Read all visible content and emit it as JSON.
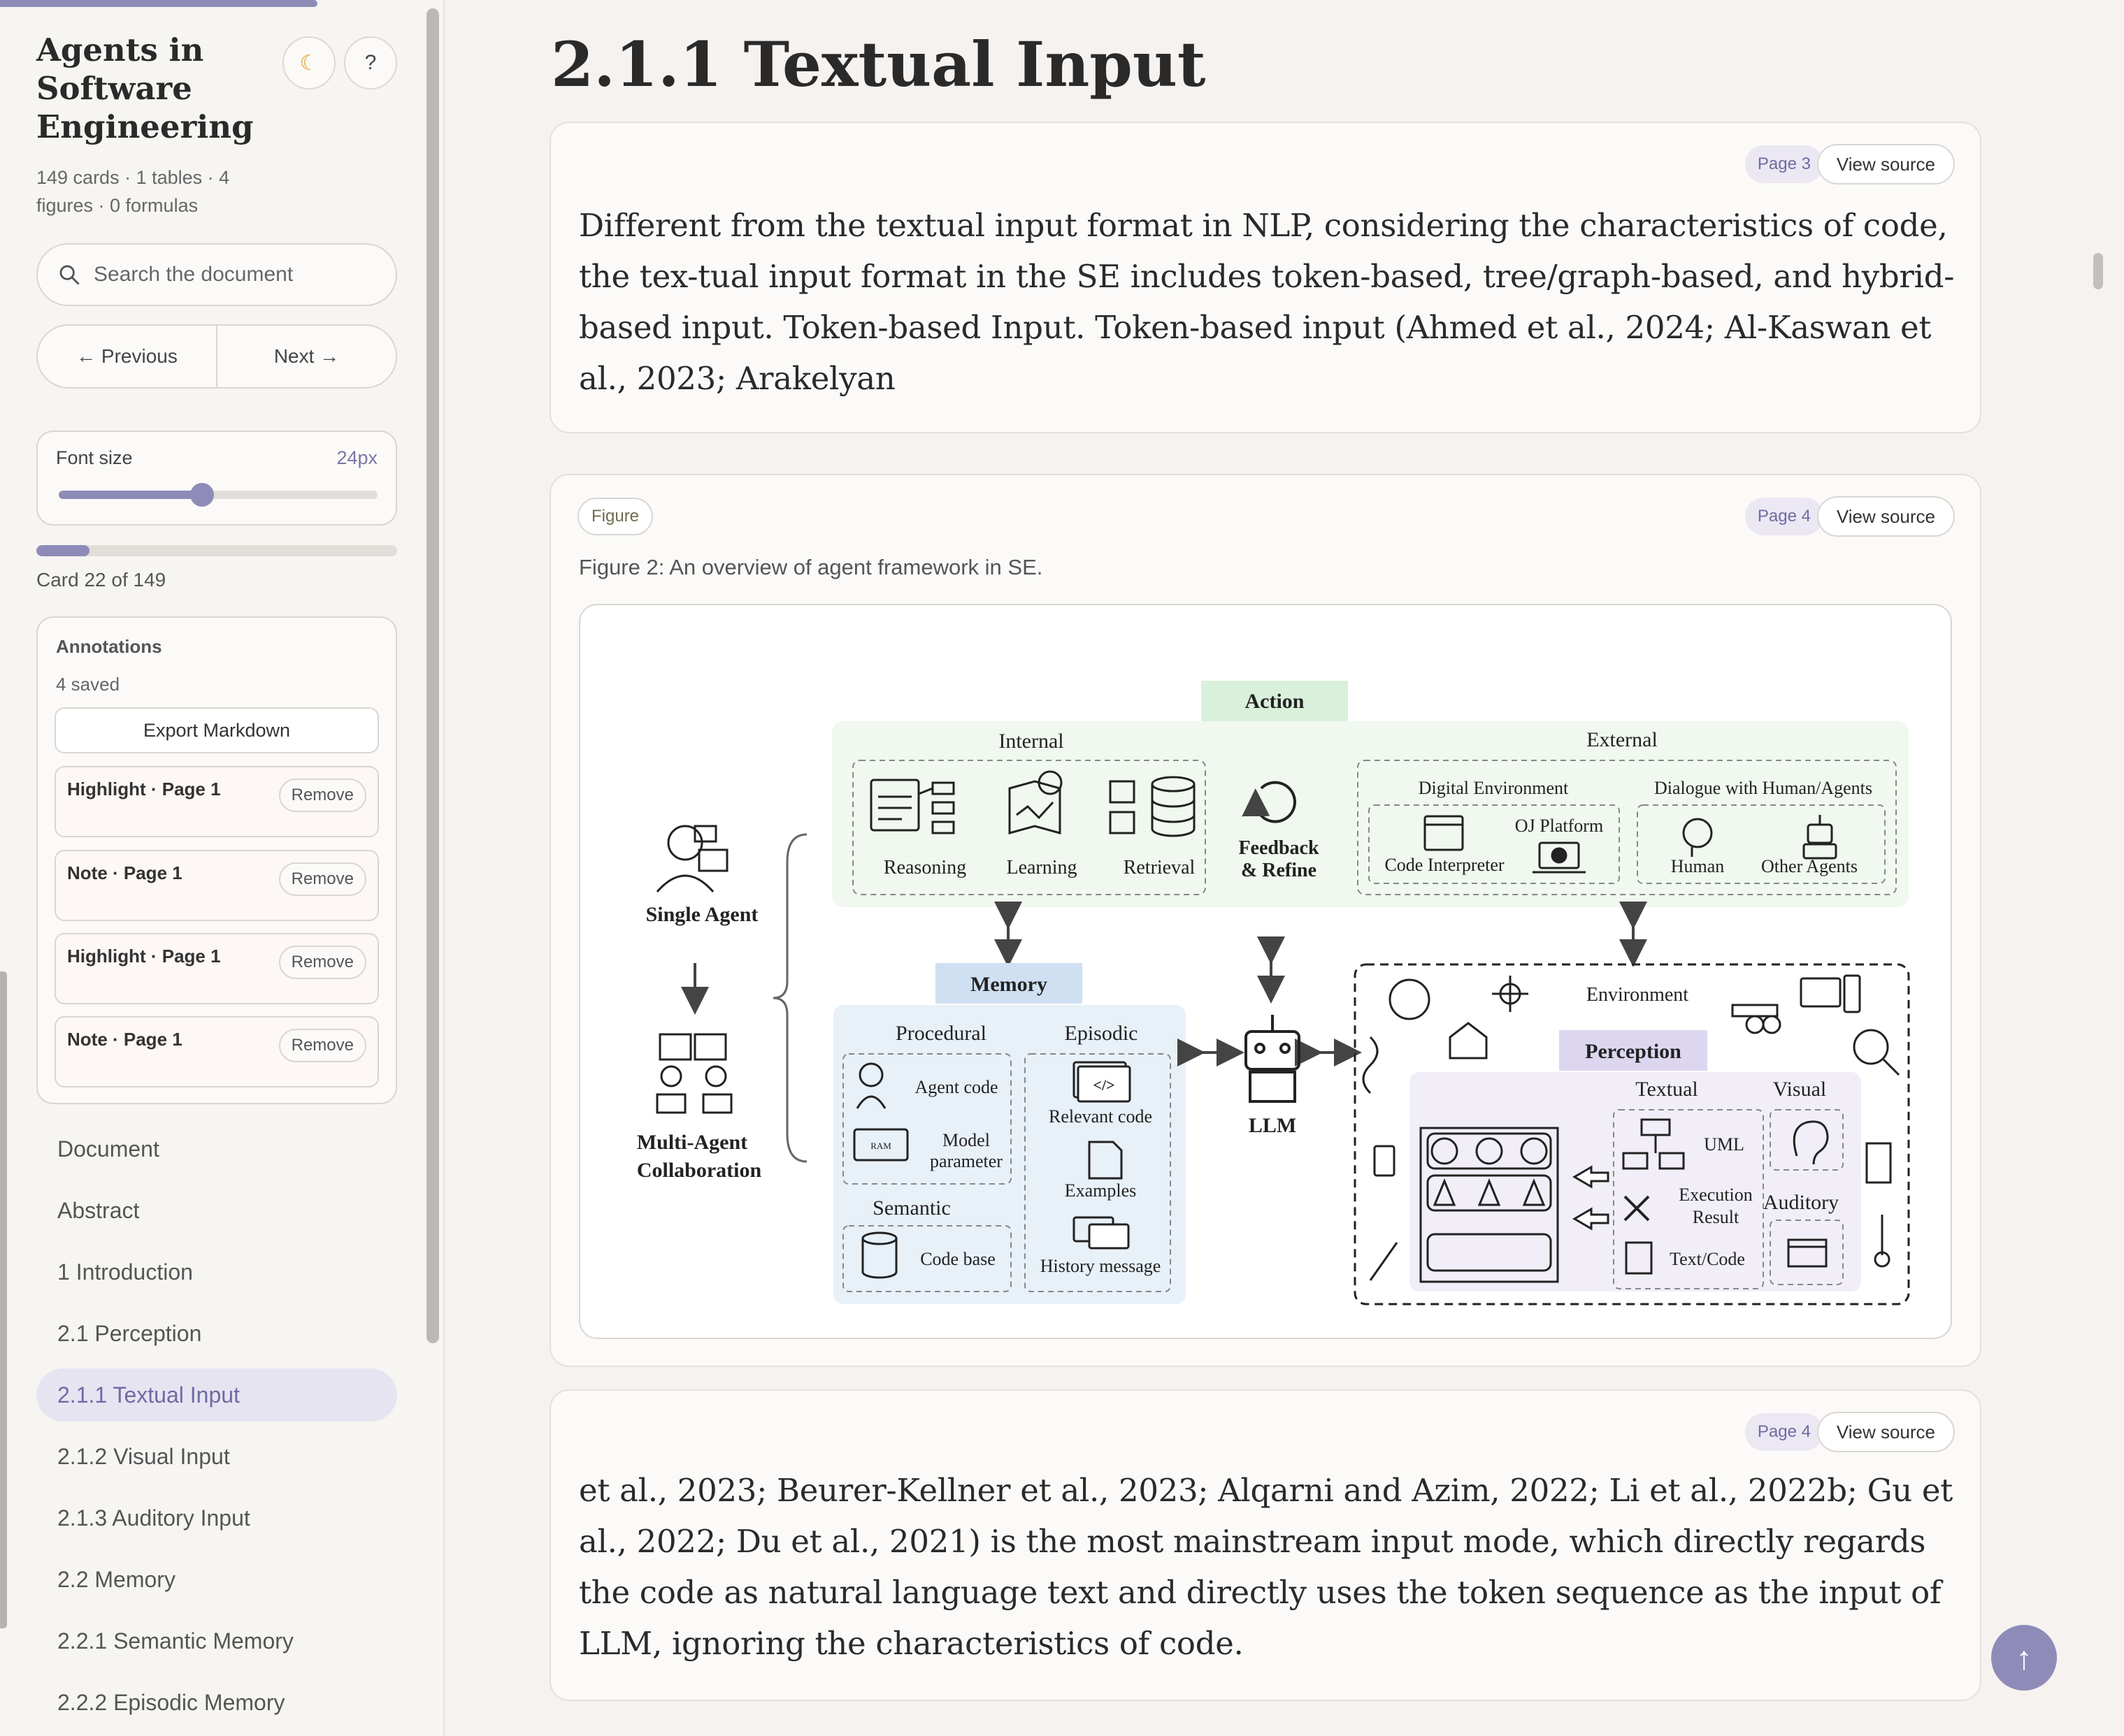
{
  "sidebar": {
    "title": "Agents in Software Engineering",
    "stats": "149 cards · 1 tables · 4 figures · 0 formulas",
    "theme_icon": "☾",
    "help_label": "?",
    "search_placeholder": "Search the document",
    "prev_label": "← Previous",
    "next_label": "Next →",
    "font_size_label": "Font size",
    "font_size_value": "24px",
    "font_slider_fraction": 0.45,
    "reading_progress_fraction": 0.148,
    "card_counter": "Card 22 of 149",
    "annotations": {
      "title": "Annotations",
      "count": "4 saved",
      "export_label": "Export Markdown",
      "remove_label": "Remove",
      "items": [
        {
          "label": "Highlight · Page 1"
        },
        {
          "label": "Note · Page 1"
        },
        {
          "label": "Highlight · Page 1"
        },
        {
          "label": "Note · Page 1"
        }
      ]
    },
    "toc": [
      {
        "label": "Document",
        "active": false
      },
      {
        "label": "Abstract",
        "active": false
      },
      {
        "label": "1 Introduction",
        "active": false
      },
      {
        "label": "2.1 Perception",
        "active": false
      },
      {
        "label": "2.1.1 Textual Input",
        "active": true
      },
      {
        "label": "2.1.2 Visual Input",
        "active": false
      },
      {
        "label": "2.1.3 Auditory Input",
        "active": false
      },
      {
        "label": "2.2 Memory",
        "active": false
      },
      {
        "label": "2.2.1 Semantic Memory",
        "active": false
      },
      {
        "label": "2.2.2 Episodic Memory",
        "active": false
      }
    ]
  },
  "main": {
    "heading": "2.1.1 Textual Input",
    "view_source_label": "View source",
    "cards": [
      {
        "page": "Page 3",
        "text": "Different from the textual input format in NLP, considering the characteristics of code, the tex-tual input format in the SE includes token-based, tree/graph-based, and hybrid-based input. Token-based Input. Token-based input (Ahmed et al., 2024; Al-Kaswan et al., 2023; Arakelyan"
      },
      {
        "page": "Page 4",
        "tag": "Figure",
        "caption": "Figure 2: An overview of agent framework in SE."
      },
      {
        "page": "Page 4",
        "text": "et al., 2023; Beurer-Kellner et al., 2023; Alqarni and Azim, 2022; Li et al., 2022b; Gu et al., 2022; Du et al., 2021) is the most mainstream input mode, which directly regards the code as natural language text and directly uses the token sequence as the input of LLM, ignoring the characteristics of code."
      }
    ],
    "scroll_top_icon": "↑"
  },
  "figure": {
    "action": "Action",
    "internal": "Internal",
    "external": "External",
    "reasoning": "Reasoning",
    "learning": "Learning",
    "retrieval": "Retrieval",
    "feedback_1": "Feedback",
    "feedback_2": "& Refine",
    "digital_env": "Digital Environment",
    "dialogue": "Dialogue with Human/Agents",
    "oj_platform": "OJ Platform",
    "code_interpreter": "Code Interpreter",
    "human": "Human",
    "other_agents": "Other Agents",
    "single_agent": "Single Agent",
    "multi_agent_1": "Multi-Agent",
    "multi_agent_2": "Collaboration",
    "memory": "Memory",
    "procedural": "Procedural",
    "episodic": "Episodic",
    "agent_code": "Agent code",
    "model_1": "Model",
    "model_2": "parameter",
    "relevant_code": "Relevant code",
    "examples": "Examples",
    "semantic": "Semantic",
    "code_base": "Code base",
    "history_message": "History message",
    "llm": "LLM",
    "environment": "Environment",
    "perception": "Perception",
    "textual": "Textual",
    "visual": "Visual",
    "uml": "UML",
    "exec_1": "Execution",
    "exec_2": "Result",
    "text_code": "Text/Code",
    "auditory": "Auditory",
    "ram": "RAM",
    "code_glyph": "</>"
  }
}
